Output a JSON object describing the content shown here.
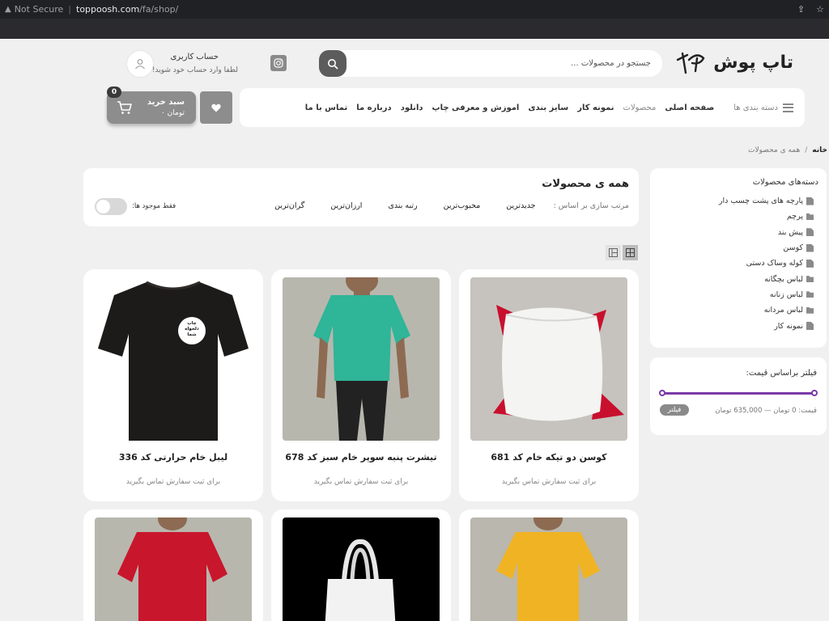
{
  "browser": {
    "security_label": "Not Secure",
    "host": "toppoosh.com",
    "path": "/fa/shop/"
  },
  "header": {
    "brand": "تاپ پوش",
    "search_placeholder": "جستجو در محصولات ...",
    "account_title": "حساب کاربری",
    "account_subtitle": "لطفا وارد حساب خود شوید!"
  },
  "nav": {
    "categories_label": "دسته بندی ها",
    "items": [
      {
        "label": "صفحه اصلی"
      },
      {
        "label": "محصولات"
      },
      {
        "label": "نمونه کار"
      },
      {
        "label": "سایز بندی"
      },
      {
        "label": "اموزش و معرفی چاپ"
      },
      {
        "label": "دانلود"
      },
      {
        "label": "درباره ما"
      },
      {
        "label": "تماس با ما"
      }
    ]
  },
  "cart": {
    "count": "0",
    "title": "سبد خرید",
    "total": "تومان ۰"
  },
  "breadcrumb": {
    "home": "خانه",
    "separator": "/",
    "current": "همه ی محصولات"
  },
  "sidebar": {
    "categories_title": "دسته‌های محصولات",
    "categories": [
      {
        "label": "پارچه های پشت چسب دار",
        "icon": "file-icon"
      },
      {
        "label": "پرچم",
        "icon": "folder-icon"
      },
      {
        "label": "پیش بند",
        "icon": "file-icon"
      },
      {
        "label": "کوسن",
        "icon": "file-icon"
      },
      {
        "label": "کوله وساک دستی",
        "icon": "file-icon"
      },
      {
        "label": "لباس بچگانه",
        "icon": "folder-icon"
      },
      {
        "label": "لباس زنانه",
        "icon": "folder-icon"
      },
      {
        "label": "لباس مردانه",
        "icon": "folder-icon"
      },
      {
        "label": "نمونه کار",
        "icon": "file-icon"
      }
    ],
    "price_filter_title": "فیلتر براساس قیمت:",
    "price_range": "قیمت: 0 تومان — 635,000 تومان",
    "filter_button": "فیلتر"
  },
  "main": {
    "title": "همه ی محصولات",
    "sort_label": "مرتب سازی بر اساس :",
    "sort_options": [
      {
        "label": "جدیدترین"
      },
      {
        "label": "محبوب‌ترین"
      },
      {
        "label": "رتبه بندی"
      },
      {
        "label": "ارزان‌ترین"
      },
      {
        "label": "گران‌ترین"
      }
    ],
    "in_stock_label": "فقط موجود ها:"
  },
  "products": [
    {
      "name": "کوسن دو تیکه خام کد 681",
      "note": "برای ثبت سفارش تماس بگیرید"
    },
    {
      "name": "تیشرت پنبه سوپر خام سبز کد 678",
      "note": "برای ثبت سفارش تماس بگیرید"
    },
    {
      "name": "لیبل خام حرارتی کد 336",
      "note": "برای ثبت سفارش تماس بگیرید",
      "badge": "چاپ دلخواه شما"
    },
    {
      "name": "",
      "note": ""
    },
    {
      "name": "",
      "note": ""
    },
    {
      "name": "",
      "note": ""
    }
  ],
  "colors": {
    "accent_purple": "#7b3aa8",
    "button_gray": "#8d8d8d",
    "page_bg": "#f0f0f0"
  }
}
